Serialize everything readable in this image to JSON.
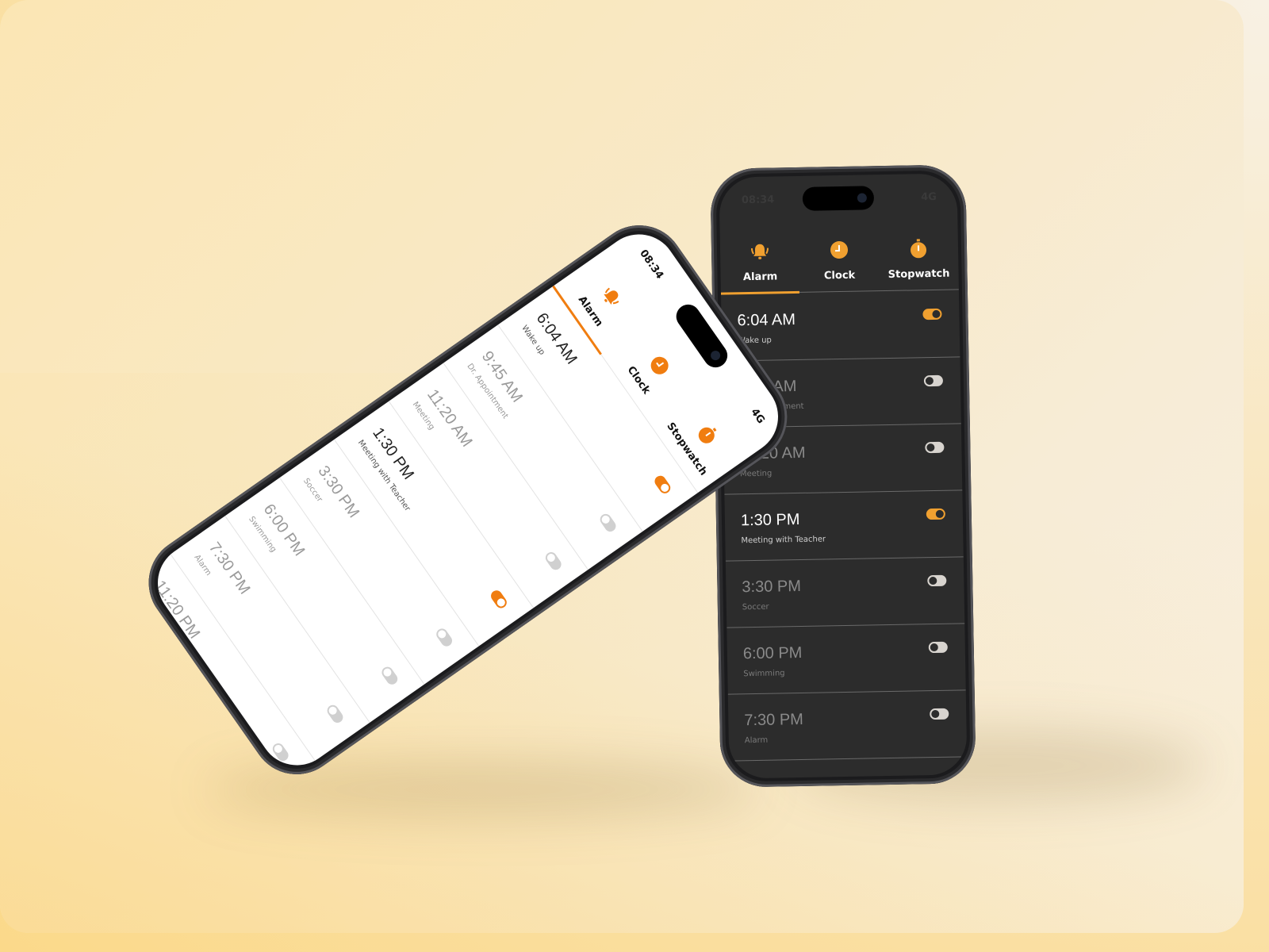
{
  "accent_dark": "#f0a030",
  "accent_light": "#f07d10",
  "status": {
    "time": "08:34",
    "network": "4G"
  },
  "tabs": [
    {
      "label": "Alarm",
      "icon": "bell-icon"
    },
    {
      "label": "Clock",
      "icon": "clock-icon"
    },
    {
      "label": "Stopwatch",
      "icon": "stopwatch-icon"
    }
  ],
  "selected_tab": "Alarm",
  "alarms": [
    {
      "time": "6:04 AM",
      "label": "Wake up",
      "enabled": true
    },
    {
      "time": "9:45 AM",
      "label": "Dr. Appointment",
      "enabled": false
    },
    {
      "time": "11:20 AM",
      "label": "Meeting",
      "enabled": false
    },
    {
      "time": "1:30 PM",
      "label": "Meeting with Teacher",
      "enabled": true
    },
    {
      "time": "3:30 PM",
      "label": "Soccer",
      "enabled": false
    },
    {
      "time": "6:00 PM",
      "label": "Swimming",
      "enabled": false
    },
    {
      "time": "7:30 PM",
      "label": "Alarm",
      "enabled": false
    },
    {
      "time": "11:20 PM",
      "label": "",
      "enabled": false
    }
  ]
}
